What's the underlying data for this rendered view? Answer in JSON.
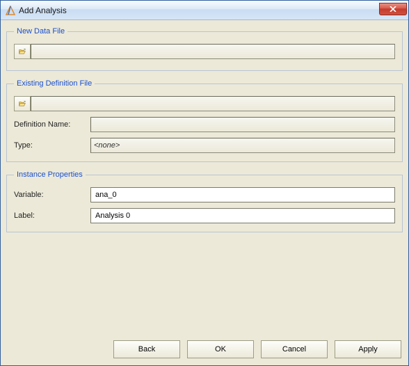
{
  "window": {
    "title": "Add Analysis"
  },
  "groups": {
    "newDataFile": {
      "legend": "New Data File"
    },
    "existingDefinitionFile": {
      "legend": "Existing Definition File"
    },
    "instanceProperties": {
      "legend": "Instance Properties"
    }
  },
  "newDataFile": {
    "path": ""
  },
  "existingDefinitionFile": {
    "path": "",
    "definitionNameLabel": "Definition Name:",
    "definitionName": "",
    "typeLabel": "Type:",
    "typeValue": "<none>"
  },
  "instanceProperties": {
    "variableLabel": "Variable:",
    "variableValue": "ana_0",
    "labelLabel": "Label:",
    "labelValue": "Analysis 0"
  },
  "buttons": {
    "back": "Back",
    "ok": "OK",
    "cancel": "Cancel",
    "apply": "Apply"
  }
}
